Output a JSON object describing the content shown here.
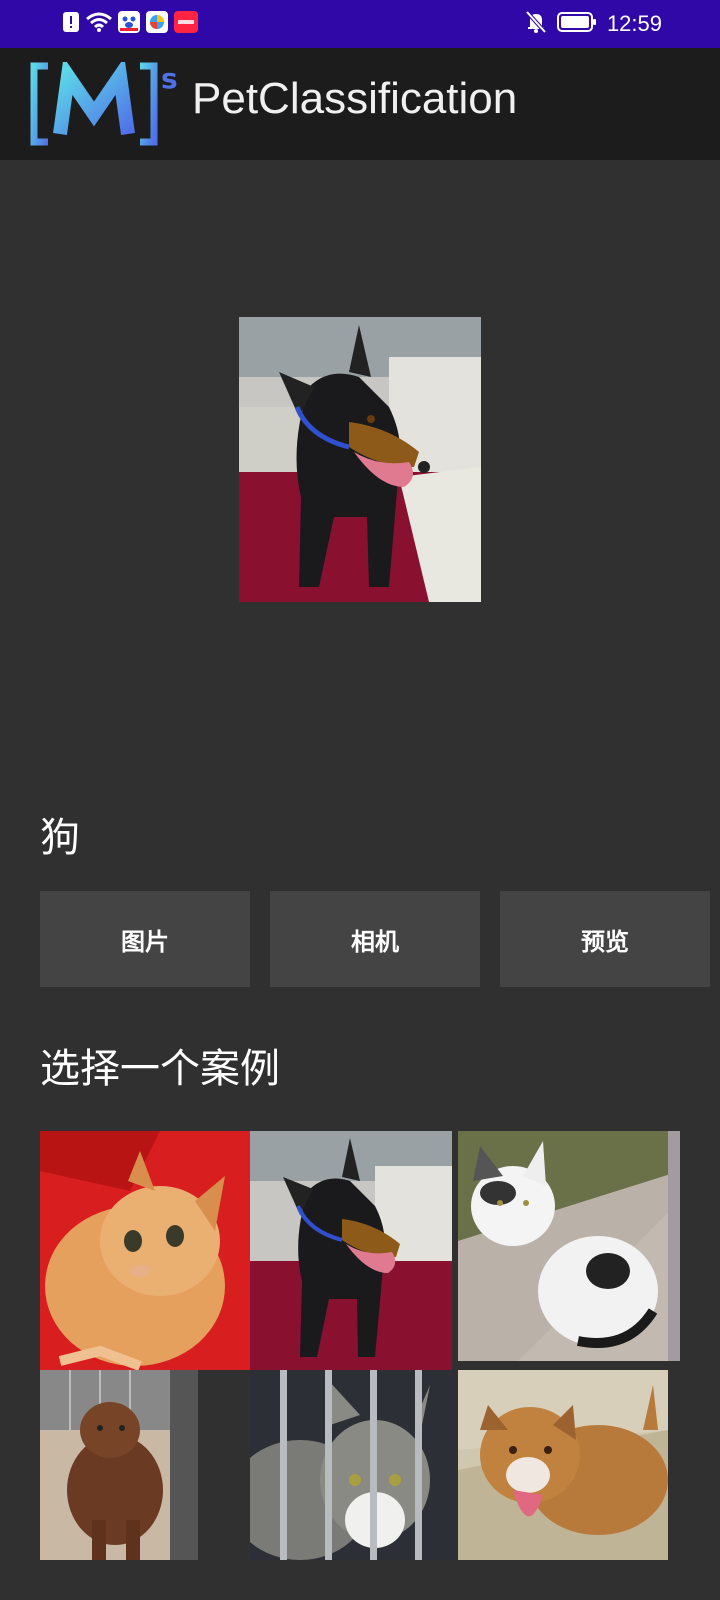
{
  "status_bar": {
    "time": "12:59",
    "left_icons": [
      "sim-alert-icon",
      "wifi-icon",
      "app-badge-icon",
      "browser-icon",
      "app-red-icon"
    ],
    "right_icons": [
      "mute-bell-icon",
      "battery-icon"
    ],
    "app_red_label": "小红书"
  },
  "app_bar": {
    "title": "PetClassification",
    "logo_text": "[M]s"
  },
  "main": {
    "result_label": "狗",
    "buttons": {
      "gallery": "图片",
      "camera": "相机",
      "preview": "预览"
    },
    "examples_title": "选择一个案例"
  },
  "colors": {
    "status_bar": "#3008a8",
    "app_bar": "#1c1c1c",
    "background": "#303030",
    "button": "#444444"
  }
}
